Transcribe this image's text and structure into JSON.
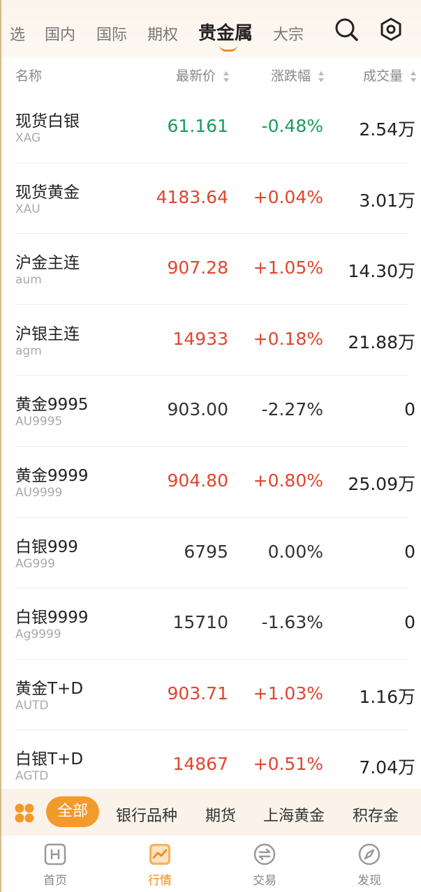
{
  "top_tabs": {
    "items": [
      "选",
      "国内",
      "国际",
      "期权",
      "贵金属",
      "大宗"
    ],
    "active": "贵金属"
  },
  "columns": {
    "name": "名称",
    "price": "最新价",
    "change": "涨跌幅",
    "volume": "成交量"
  },
  "rows": [
    {
      "name": "现货白银",
      "code": "XAG",
      "price": "61.161",
      "change": "-0.48%",
      "volume": "2.54万",
      "trend": "down"
    },
    {
      "name": "现货黄金",
      "code": "XAU",
      "price": "4183.64",
      "change": "+0.04%",
      "volume": "3.01万",
      "trend": "up"
    },
    {
      "name": "沪金主连",
      "code": "aum",
      "price": "907.28",
      "change": "+1.05%",
      "volume": "14.30万",
      "trend": "up"
    },
    {
      "name": "沪银主连",
      "code": "agm",
      "price": "14933",
      "change": "+0.18%",
      "volume": "21.88万",
      "trend": "up"
    },
    {
      "name": "黄金9995",
      "code": "AU9995",
      "price": "903.00",
      "change": "-2.27%",
      "volume": "0",
      "trend": "flat"
    },
    {
      "name": "黄金9999",
      "code": "AU9999",
      "price": "904.80",
      "change": "+0.80%",
      "volume": "25.09万",
      "trend": "up"
    },
    {
      "name": "白银999",
      "code": "AG999",
      "price": "6795",
      "change": "0.00%",
      "volume": "0",
      "trend": "flat"
    },
    {
      "name": "白银9999",
      "code": "Ag9999",
      "price": "15710",
      "change": "-1.63%",
      "volume": "0",
      "trend": "flat"
    },
    {
      "name": "黄金T+D",
      "code": "AUTD",
      "price": "903.71",
      "change": "+1.03%",
      "volume": "1.16万",
      "trend": "up"
    },
    {
      "name": "白银T+D",
      "code": "AGTD",
      "price": "14867",
      "change": "+0.51%",
      "volume": "7.04万",
      "trend": "up"
    }
  ],
  "categories": {
    "items": [
      "全部",
      "银行品种",
      "期货",
      "上海黄金",
      "积存金"
    ],
    "active": "全部"
  },
  "bottom_nav": {
    "items": [
      {
        "label": "首页",
        "icon": "home-h-icon"
      },
      {
        "label": "行情",
        "icon": "chart-line-icon"
      },
      {
        "label": "交易",
        "icon": "exchange-icon"
      },
      {
        "label": "发现",
        "icon": "compass-icon"
      }
    ],
    "active": "行情"
  },
  "colors": {
    "accent": "#f08a1c",
    "up": "#e0452f",
    "down": "#1e9a5b"
  }
}
